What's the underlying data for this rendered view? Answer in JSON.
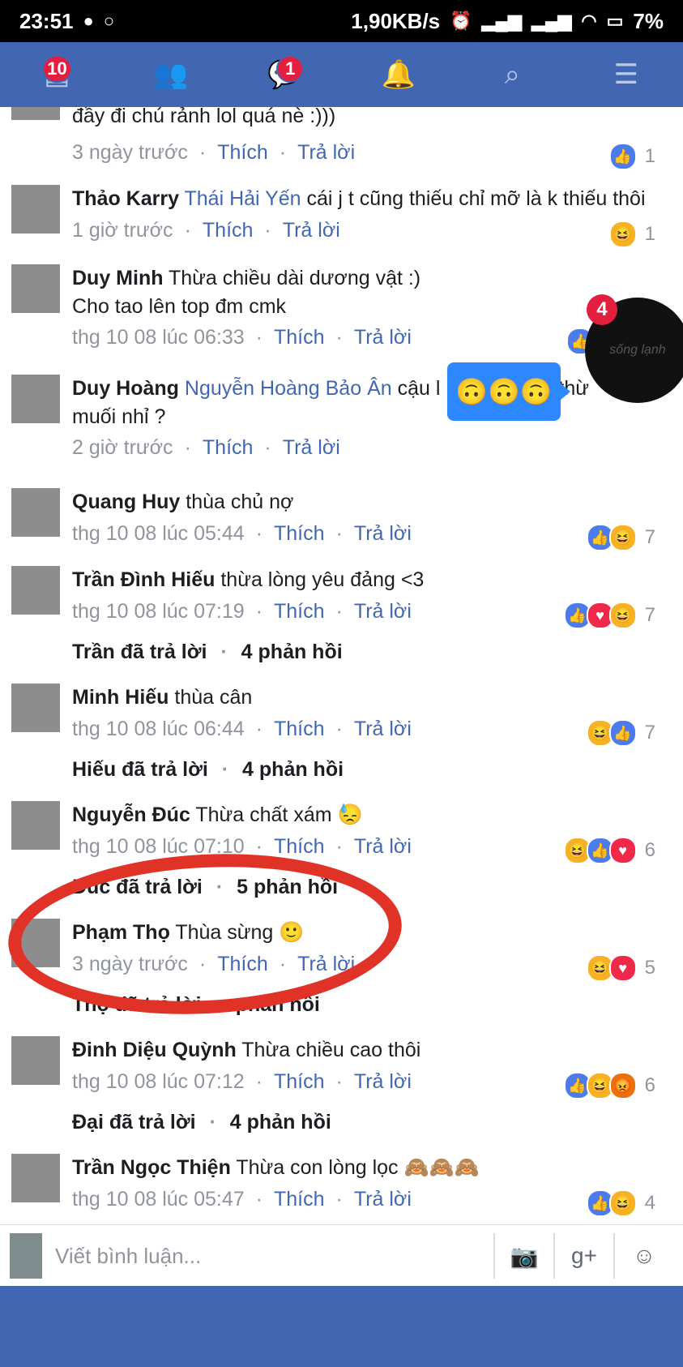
{
  "status": {
    "time": "23:51",
    "speed": "1,90KB/s",
    "battery": "7%"
  },
  "nav": {
    "news_badge": "10",
    "messages_badge": "1"
  },
  "comments": [
    {
      "author": "",
      "mention": "",
      "text": "đầy đi chú rảnh lol quá nè :)))",
      "time": "3 ngày trước",
      "like": "Thích",
      "reply": "Trả lời",
      "reactions": [
        "like"
      ],
      "count": "1"
    },
    {
      "author": "Thảo Karry",
      "mention": "Thái Hải Yến",
      "text": "cái j t cũng thiếu chỉ mỡ là k thiếu thôi",
      "time": "1 giờ trước",
      "like": "Thích",
      "reply": "Trả lời",
      "reactions": [
        "haha"
      ],
      "count": "1"
    },
    {
      "author": "Duy Minh",
      "mention": "",
      "text": "Thừa chiều dài dương vật :)",
      "text2": "Cho tao lên top đm cmk",
      "time": "thg 10 08 lúc 06:33",
      "like": "Thích",
      "reply": "Trả lời",
      "reactions": [
        "like"
      ],
      "count": ""
    },
    {
      "author": "Duy Hoàng",
      "mention": "Nguyễn Hoàng Bảo Ân",
      "text": "cậu l",
      "text_tail": "thừ",
      "text2": "muối nhỉ ?",
      "time": "2 giờ trước",
      "like": "Thích",
      "reply": "Trả lời",
      "reactions": [],
      "count": ""
    },
    {
      "author": "Quang Huy",
      "mention": "",
      "text": "thùa chủ nợ",
      "time": "thg 10 08 lúc 05:44",
      "like": "Thích",
      "reply": "Trả lời",
      "reactions": [
        "like",
        "haha"
      ],
      "count": "7"
    },
    {
      "author": "Trần Đình Hiếu",
      "mention": "",
      "text": "thừa lòng yêu đảng <3",
      "time": "thg 10 08 lúc 07:19",
      "like": "Thích",
      "reply": "Trả lời",
      "reactions": [
        "like",
        "love",
        "haha"
      ],
      "count": "7",
      "replies_by": "Trần đã trả lời",
      "replies_count": "4 phản hồi"
    },
    {
      "author": "Minh Hiếu",
      "mention": "",
      "text": "thùa cân",
      "time": "thg 10 08 lúc 06:44",
      "like": "Thích",
      "reply": "Trả lời",
      "reactions": [
        "haha",
        "like"
      ],
      "count": "7",
      "replies_by": "Hiếu đã trả lời",
      "replies_count": "4 phản hồi"
    },
    {
      "author": "Nguyễn Đúc",
      "mention": "",
      "text": "Thừa chất xám 😓",
      "time": "thg 10 08 lúc 07:10",
      "like": "Thích",
      "reply": "Trả lời",
      "reactions": [
        "haha",
        "like",
        "love"
      ],
      "count": "6",
      "replies_by": "Đúc đã trả lời",
      "replies_count": "5 phản hồi"
    },
    {
      "author": "Phạm Thọ",
      "mention": "",
      "text": "Thùa sừng 🙂",
      "time": "3 ngày trước",
      "like": "Thích",
      "reply": "Trả lời",
      "reactions": [
        "haha",
        "love"
      ],
      "count": "5",
      "replies_by": "Thọ đã trả lời",
      "replies_count": "phản hồi"
    },
    {
      "author": "Đinh Diệu Quỳnh",
      "mention": "",
      "text": "Thừa chiều cao thôi",
      "time": "thg 10 08 lúc 07:12",
      "like": "Thích",
      "reply": "Trả lời",
      "reactions": [
        "like",
        "haha",
        "angry"
      ],
      "count": "6",
      "replies_by": "Đại đã trả lời",
      "replies_count": "4 phản hồi"
    },
    {
      "author": "Trần Ngọc Thiện",
      "mention": "",
      "text": "Thừa con lòng lọc 🙈🙈🙈",
      "time": "thg 10 08 lúc 05:47",
      "like": "Thích",
      "reply": "Trả lời",
      "reactions": [
        "like",
        "haha"
      ],
      "count": "4"
    }
  ],
  "chathead": {
    "badge": "4",
    "label": "sống lạnh"
  },
  "bubble_emojis": "🙃🙃🙃",
  "composer": {
    "placeholder": "Viết bình luận..."
  }
}
